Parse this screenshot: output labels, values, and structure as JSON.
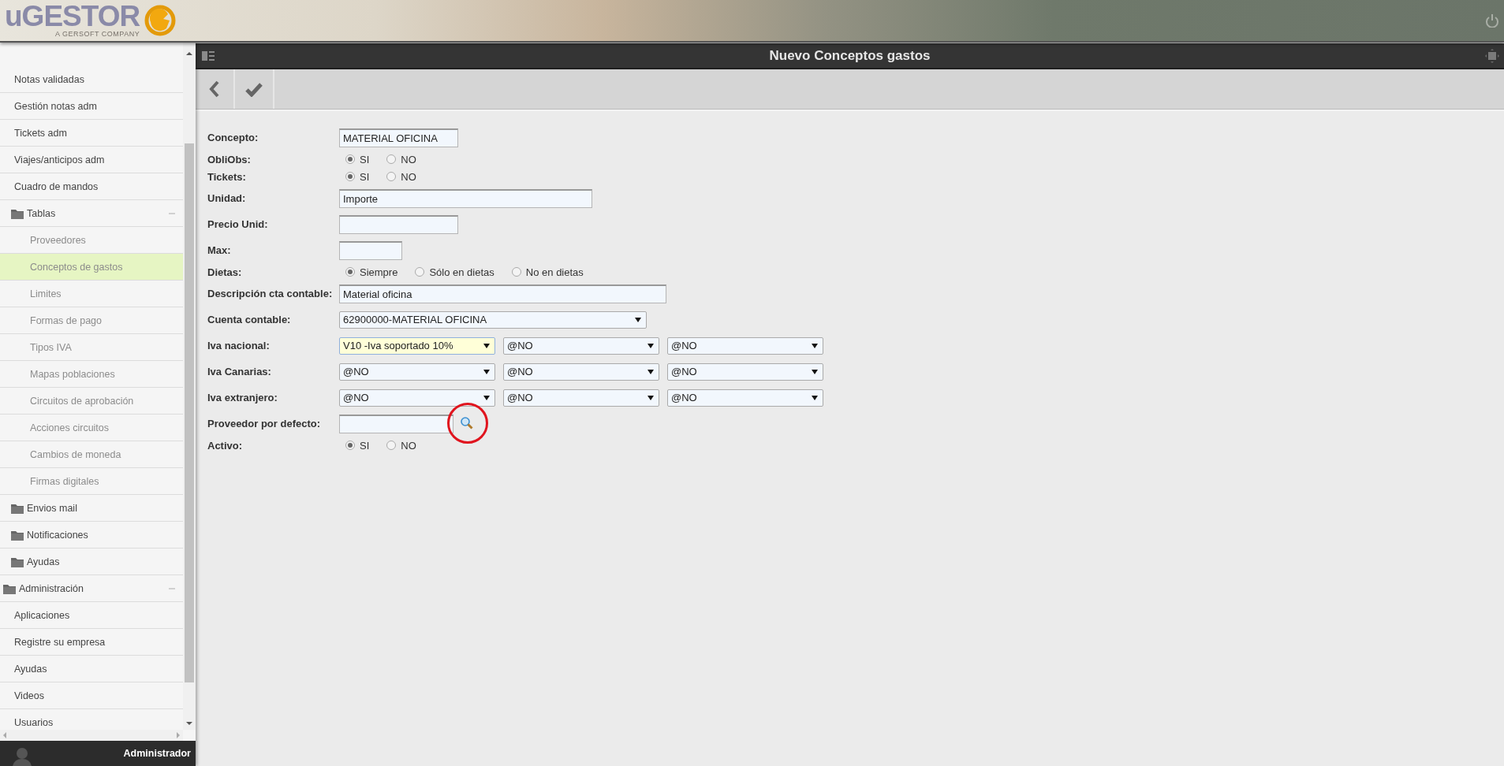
{
  "header": {
    "logo_text": "uGESTOR",
    "logo_tagline": "A GERSOFT COMPANY"
  },
  "sidebar": {
    "items": [
      {
        "kind": "group",
        "children": [
          {
            "kind": "link",
            "label": "Notas validadas",
            "selected": false
          },
          {
            "kind": "link",
            "label": "Gestión notas adm",
            "selected": false
          },
          {
            "kind": "link",
            "label": "Tickets adm",
            "selected": false
          },
          {
            "kind": "link",
            "label": "Viajes/anticipos adm",
            "selected": false
          },
          {
            "kind": "link",
            "label": "Cuadro de mandos",
            "selected": false
          },
          {
            "kind": "folder",
            "label": "Tablas",
            "expanded": true,
            "children": [
              {
                "kind": "link",
                "label": "Proveedores",
                "selected": false
              },
              {
                "kind": "link",
                "label": "Conceptos de gastos",
                "selected": true
              },
              {
                "kind": "link",
                "label": "Limites",
                "selected": false
              },
              {
                "kind": "link",
                "label": "Formas de pago",
                "selected": false
              },
              {
                "kind": "link",
                "label": "Tipos IVA",
                "selected": false
              },
              {
                "kind": "link",
                "label": "Mapas poblaciones",
                "selected": false
              },
              {
                "kind": "link",
                "label": "Circuitos de aprobación",
                "selected": false
              },
              {
                "kind": "link",
                "label": "Acciones circuitos",
                "selected": false
              },
              {
                "kind": "link",
                "label": "Cambios de moneda",
                "selected": false
              },
              {
                "kind": "link",
                "label": "Firmas digitales",
                "selected": false
              }
            ]
          },
          {
            "kind": "folder",
            "label": "Envios mail",
            "expanded": false
          },
          {
            "kind": "folder",
            "label": "Notificaciones",
            "expanded": false
          },
          {
            "kind": "folder",
            "label": "Ayudas",
            "expanded": false
          }
        ]
      },
      {
        "kind": "folder",
        "label": "Administración",
        "expanded": true,
        "children": [
          {
            "kind": "link",
            "label": "Aplicaciones",
            "selected": false
          },
          {
            "kind": "link",
            "label": "Registre su empresa",
            "selected": false
          },
          {
            "kind": "link",
            "label": "Ayudas",
            "selected": false
          },
          {
            "kind": "link",
            "label": "Videos",
            "selected": false
          },
          {
            "kind": "link",
            "label": "Usuarios",
            "selected": false
          }
        ]
      }
    ],
    "user": "Administrador"
  },
  "title_bar": {
    "title": "Nuevo Conceptos gastos"
  },
  "form": {
    "fields": [
      {
        "kind": "text",
        "label": "Concepto:",
        "value": "MATERIAL OFICINA"
      },
      {
        "kind": "radio",
        "label": "ObliObs:",
        "options": [
          {
            "label": "SI",
            "selected": true
          },
          {
            "label": "NO",
            "selected": false
          }
        ]
      },
      {
        "kind": "radio",
        "label": "Tickets:",
        "options": [
          {
            "label": "SI",
            "selected": true
          },
          {
            "label": "NO",
            "selected": false
          }
        ]
      },
      {
        "kind": "text",
        "label": "Unidad:",
        "value": "Importe"
      },
      {
        "kind": "text",
        "label": "Precio Unid:"
      },
      {
        "kind": "text",
        "label": "Max:"
      },
      {
        "kind": "radio",
        "label": "Dietas:",
        "options": [
          {
            "label": "Siempre",
            "selected": true
          },
          {
            "label": "Sólo en dietas",
            "selected": false
          },
          {
            "label": "No en dietas",
            "selected": false
          }
        ]
      },
      {
        "kind": "text",
        "label": "Descripción cta contable:",
        "value": "Material oficina"
      },
      {
        "kind": "select",
        "label": "Cuenta contable:",
        "value": "62900000-MATERIAL OFICINA"
      },
      {
        "kind": "selects",
        "label": "Iva nacional:",
        "selects": [
          {
            "value": "V10 -Iva soportado 10%",
            "focused": true
          },
          {
            "value": "@NO",
            "focused": false
          },
          {
            "value": "@NO",
            "focused": false
          }
        ]
      },
      {
        "kind": "selects",
        "label": "Iva Canarias:",
        "selects": [
          {
            "value": "@NO",
            "focused": false
          },
          {
            "value": "@NO",
            "focused": false
          },
          {
            "value": "@NO",
            "focused": false
          }
        ]
      },
      {
        "kind": "selects",
        "label": "Iva extranjero:",
        "selects": [
          {
            "value": "@NO",
            "focused": false
          },
          {
            "value": "@NO",
            "focused": false
          },
          {
            "value": "@NO",
            "focused": false
          }
        ]
      },
      {
        "kind": "lookup",
        "label": "Proveedor por defecto:",
        "circled": true
      },
      {
        "kind": "radio",
        "label": "Activo:",
        "options": [
          {
            "label": "SI",
            "selected": true
          },
          {
            "label": "NO",
            "selected": false
          }
        ]
      }
    ]
  }
}
